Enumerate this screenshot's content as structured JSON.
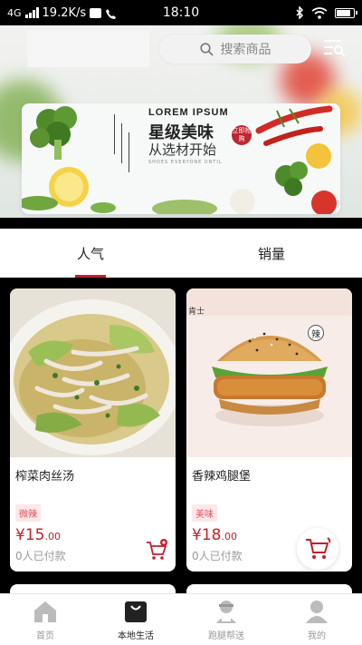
{
  "status_bar": {
    "network": "4G",
    "speed": "19.2K/s",
    "time": "18:10"
  },
  "header": {
    "search_placeholder": "搜索商品",
    "menu_icon": "menu-search-icon"
  },
  "banner": {
    "title_en": "LOREM IPSUM",
    "title": "星级美味",
    "subtitle": "从选材开始",
    "small_text": "SHOES EVERYONE UNTIL",
    "badge": "立即抢购"
  },
  "tabs": [
    {
      "label": "人气",
      "active": true
    },
    {
      "label": "销量",
      "active": false
    }
  ],
  "products": [
    {
      "name": "榨菜肉丝汤",
      "tag": "微辣",
      "price_int": "¥15",
      "price_dec": ".00",
      "sold": "0人已付款"
    },
    {
      "name": "香辣鸡腿堡",
      "tag": "美味",
      "price_int": "¥18",
      "price_dec": ".00",
      "sold": "0人已付款",
      "img_tag": "辣",
      "img_brand": "肯士"
    }
  ],
  "bottom_nav": [
    {
      "label": "首页",
      "icon": "home-icon",
      "active": false
    },
    {
      "label": "本地生活",
      "icon": "bag-icon",
      "active": true
    },
    {
      "label": "跑腿帮送",
      "icon": "courier-icon",
      "active": false
    },
    {
      "label": "我的",
      "icon": "user-icon",
      "active": false
    }
  ],
  "colors": {
    "accent": "#c21f2b",
    "tag_bg": "#fde8ea"
  }
}
